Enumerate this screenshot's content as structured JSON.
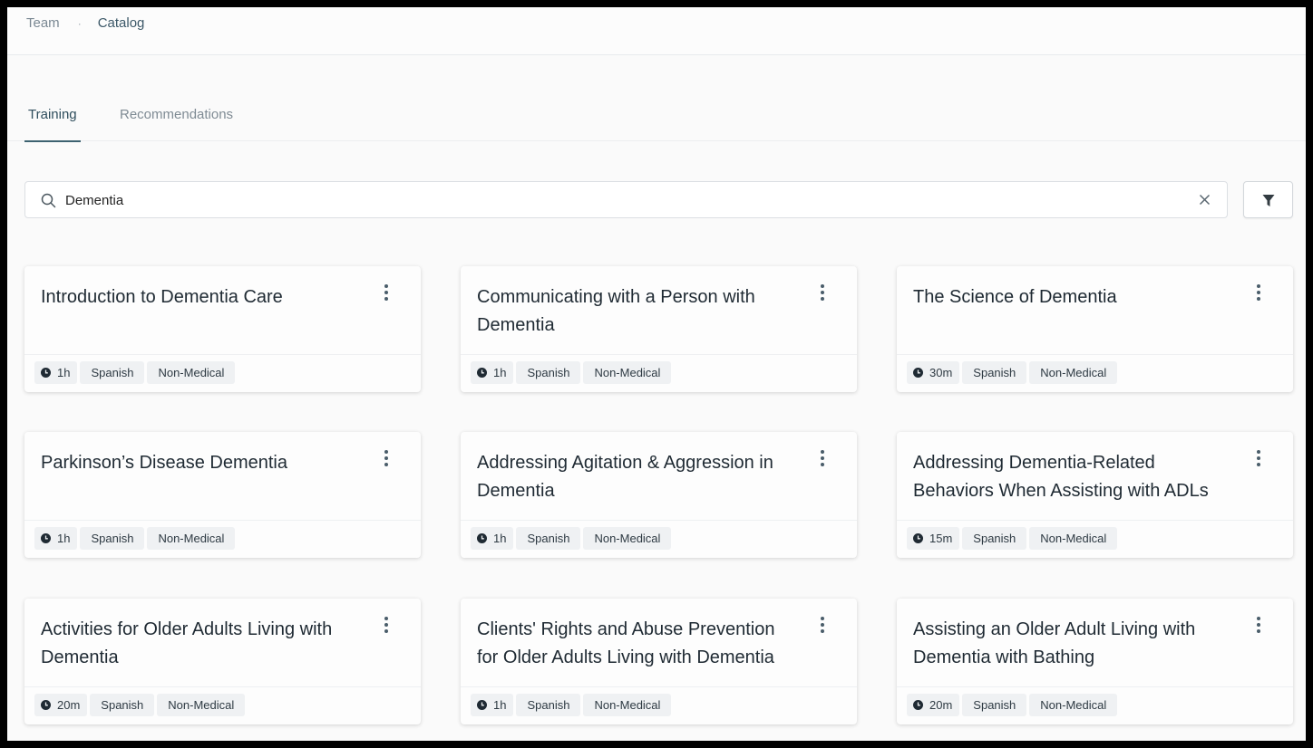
{
  "breadcrumb": {
    "items": [
      "Team",
      "Catalog"
    ],
    "separator": "·"
  },
  "tabs": [
    {
      "label": "Training",
      "active": true
    },
    {
      "label": "Recommendations",
      "active": false
    }
  ],
  "search": {
    "value": "Dementia",
    "placeholder": ""
  },
  "colors": {
    "accent": "#3d6270",
    "chip_bg": "#eff1f3"
  },
  "cards": [
    {
      "title": "Introduction to Dementia Care",
      "duration": "1h",
      "language": "Spanish",
      "category": "Non-Medical"
    },
    {
      "title": "Communicating with a Person with Dementia",
      "duration": "1h",
      "language": "Spanish",
      "category": "Non-Medical"
    },
    {
      "title": "The Science of Dementia",
      "duration": "30m",
      "language": "Spanish",
      "category": "Non-Medical"
    },
    {
      "title": "Parkinson’s Disease Dementia",
      "duration": "1h",
      "language": "Spanish",
      "category": "Non-Medical"
    },
    {
      "title": "Addressing Agitation & Aggression in Dementia",
      "duration": "1h",
      "language": "Spanish",
      "category": "Non-Medical"
    },
    {
      "title": "Addressing Dementia-Related Behaviors When Assisting with ADLs",
      "duration": "15m",
      "language": "Spanish",
      "category": "Non-Medical"
    },
    {
      "title": "Activities for Older Adults Living with Dementia",
      "duration": "20m",
      "language": "Spanish",
      "category": "Non-Medical"
    },
    {
      "title": "Clients' Rights and Abuse Prevention for Older Adults Living with Dementia",
      "duration": "1h",
      "language": "Spanish",
      "category": "Non-Medical"
    },
    {
      "title": "Assisting an Older Adult Living with Dementia with Bathing",
      "duration": "20m",
      "language": "Spanish",
      "category": "Non-Medical"
    }
  ]
}
